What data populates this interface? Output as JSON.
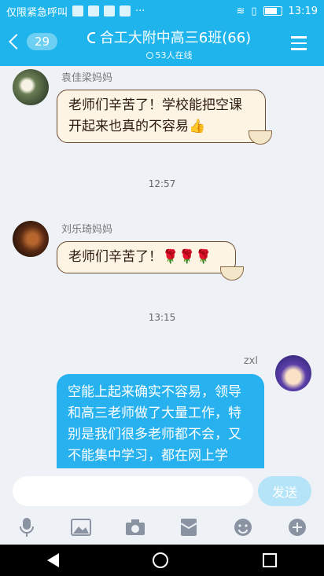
{
  "status_bar": {
    "left_text": "仅限紧急呼叫",
    "more": "···",
    "time": "13:19"
  },
  "header": {
    "unread_count": "29",
    "title": "合工大附中高三6班(66)",
    "online_text": "53人在线"
  },
  "messages": [
    {
      "sender": "袁佳梁妈妈",
      "text": "老师们辛苦了！学校能把空课开起来也真的不容易👍"
    },
    {
      "timestamp": "12:57"
    },
    {
      "sender": "刘乐琦妈妈",
      "text": "老师们辛苦了！🌹🌹🌹"
    },
    {
      "timestamp": "13:15"
    },
    {
      "sender": "zxl",
      "text": "空能上起来确实不容易，领导和高三老师做了大量工作，特别是我们很多老师都不会，又不能集中学习，都在网上学习，他们已经相互"
    }
  ],
  "input": {
    "placeholder": "",
    "send_label": "发送"
  },
  "toolbar_icons": [
    "microphone-icon",
    "image-icon",
    "camera-icon",
    "red-packet-icon",
    "emoji-icon",
    "plus-icon"
  ],
  "colors": {
    "accent": "#1fb5ec",
    "incoming_bubble": "#fdf4e3",
    "outgoing_bubble": "#27b2ef"
  }
}
